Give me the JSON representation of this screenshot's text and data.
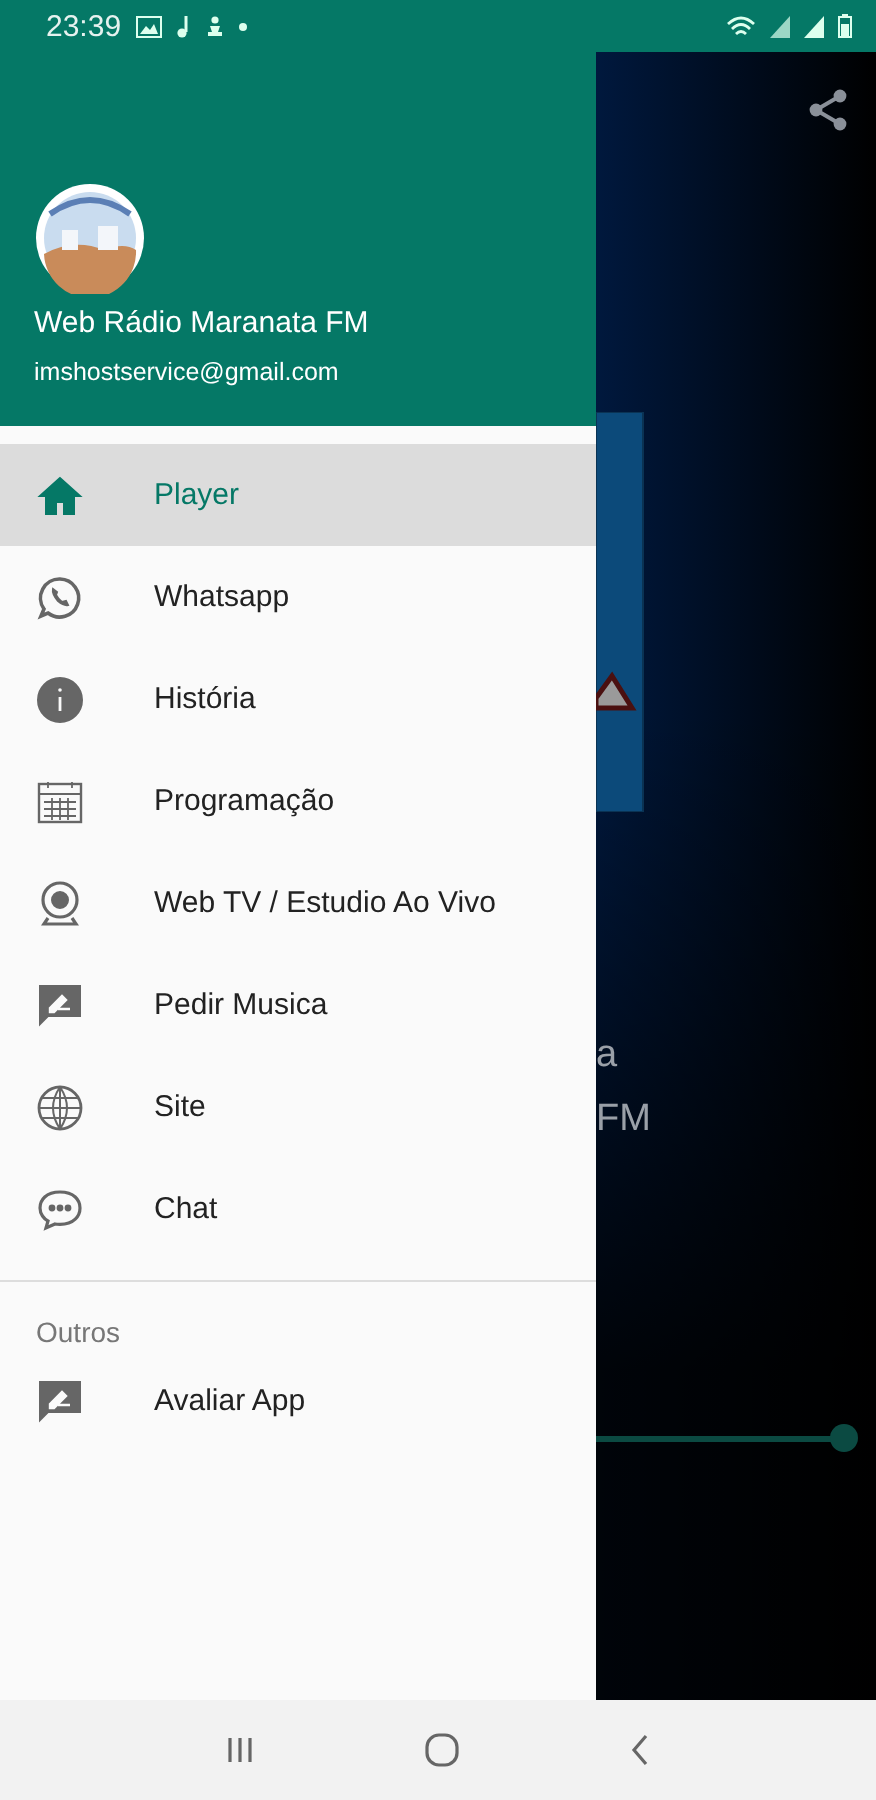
{
  "status_bar": {
    "time": "23:39"
  },
  "background": {
    "partial_texts": [
      "a",
      "FM"
    ],
    "volume": {
      "level": 0.96
    }
  },
  "drawer": {
    "header": {
      "title": "Web Rádio Maranata FM",
      "email": "imshostservice@gmail.com"
    },
    "items": [
      {
        "label": "Player",
        "kind": "home",
        "selected": true
      },
      {
        "label": "Whatsapp",
        "kind": "whatsapp",
        "selected": false
      },
      {
        "label": "História",
        "kind": "info",
        "selected": false
      },
      {
        "label": "Programação",
        "kind": "calendar",
        "selected": false
      },
      {
        "label": "Web TV / Estudio Ao Vivo",
        "kind": "webcam",
        "selected": false
      },
      {
        "label": "Pedir Musica",
        "kind": "feedback",
        "selected": false
      },
      {
        "label": "Site",
        "kind": "globe",
        "selected": false
      },
      {
        "label": "Chat",
        "kind": "chat",
        "selected": false
      }
    ],
    "section": {
      "title": "Outros",
      "items": [
        {
          "label": "Avaliar App",
          "kind": "feedback",
          "selected": false
        }
      ]
    }
  }
}
